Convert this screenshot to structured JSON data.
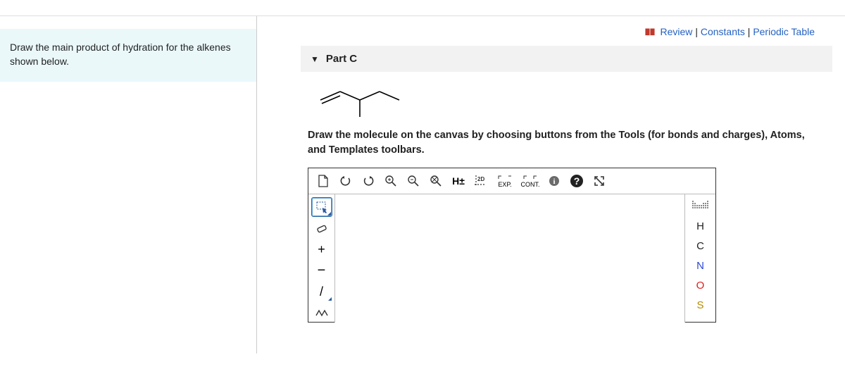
{
  "toplinks": {
    "review": "Review",
    "constants": "Constants",
    "periodic": "Periodic Table",
    "sep": "|"
  },
  "question": "Draw the main product of hydration for the alkenes shown below.",
  "part": {
    "label": "Part C"
  },
  "instructions": "Draw the molecule on the canvas by choosing buttons from the Tools (for bonds and charges), Atoms, and Templates toolbars.",
  "toolbar": {
    "hpm": "H±",
    "twod": "2D",
    "exp": "EXP.",
    "cont": "CONT."
  },
  "atoms": {
    "h": "H",
    "c": "C",
    "n": "N",
    "o": "O",
    "s": "S"
  },
  "left_tools": {
    "plus": "+",
    "minus": "−",
    "single": "/"
  }
}
